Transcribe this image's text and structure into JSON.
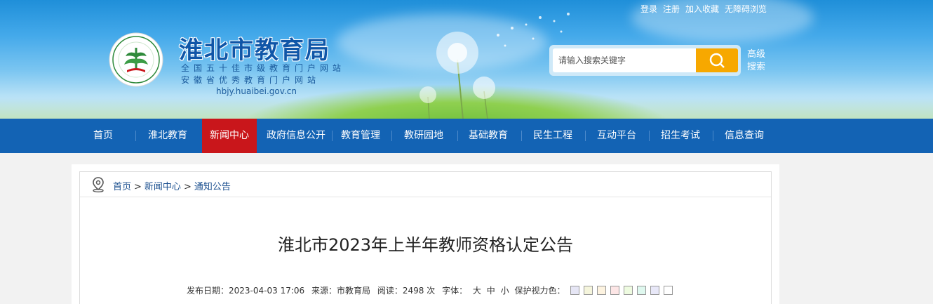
{
  "top_links": [
    "登录",
    "注册",
    "加入收藏",
    "无障碍浏览"
  ],
  "site": {
    "title": "淮北市教育局",
    "subtitle_1": "全国五十佳市级教育门户网站",
    "subtitle_2": "安徽省优秀教育门户网站",
    "url": "hbjy.huaibei.gov.cn"
  },
  "search": {
    "placeholder": "请输入搜索关键字",
    "advanced_line1": "高级",
    "advanced_line2": "搜索"
  },
  "nav": [
    {
      "label": "首页"
    },
    {
      "label": "淮北教育"
    },
    {
      "label": "新闻中心",
      "active": true
    },
    {
      "label": "政府信息公开"
    },
    {
      "label": "教育管理"
    },
    {
      "label": "教研园地"
    },
    {
      "label": "基础教育"
    },
    {
      "label": "民生工程"
    },
    {
      "label": "互动平台"
    },
    {
      "label": "招生考试"
    },
    {
      "label": "信息查询"
    }
  ],
  "breadcrumb": [
    "首页",
    "新闻中心",
    "通知公告"
  ],
  "breadcrumb_sep": ">",
  "article": {
    "title": "淮北市2023年上半年教师资格认定公告",
    "publish_label": "发布日期：",
    "publish_date": "2023-04-03 17:06",
    "source_label": "来源：",
    "source": "市教育局",
    "reads_label": "阅读：",
    "reads": "2498",
    "reads_unit": "次",
    "font_label": "字体：",
    "font_sizes": [
      "大",
      "中",
      "小"
    ],
    "eye_label": "保护视力色："
  },
  "colors": {
    "nav_bg": "#1363b4",
    "nav_active": "#c9161b",
    "search_button": "#f7a800",
    "title_blue": "#0f56a8",
    "eye_swatches": [
      "#e6e6f5",
      "#f5f5dc",
      "#fdf3e0",
      "#fde6e6",
      "#eefbe0",
      "#dff8ef",
      "#e8e8f8",
      "#ffffff"
    ]
  }
}
